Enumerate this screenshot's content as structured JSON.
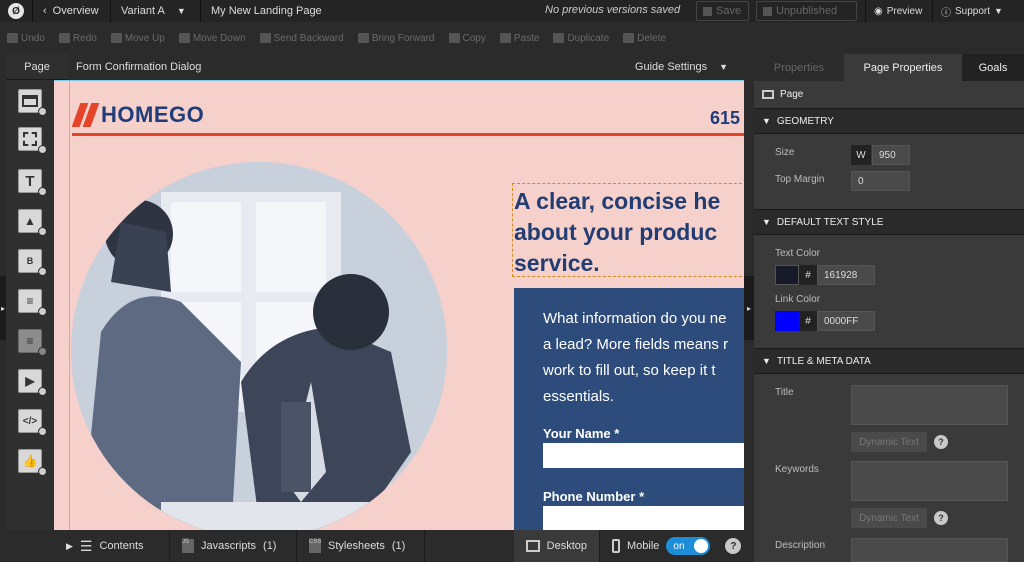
{
  "topbar": {
    "logo": "Ø",
    "back_label": "Overview",
    "variant_label": "Variant A",
    "page_name": "My New Landing Page",
    "status": "No previous versions saved",
    "save_label": "Save",
    "unpublished_label": "Unpublished",
    "preview_label": "Preview",
    "support_label": "Support"
  },
  "toolbar": {
    "items": [
      "Undo",
      "Redo",
      "Move Up",
      "Move Down",
      "Send Backward",
      "Bring Forward",
      "Copy",
      "Paste",
      "Duplicate",
      "Delete"
    ]
  },
  "left": {
    "page_tab": "Page",
    "tools": [
      "section-icon",
      "box-icon",
      "text-icon",
      "image-icon",
      "button-icon",
      "form-icon",
      "social-icon",
      "video-icon",
      "custom-html-icon",
      "social-widget-icon"
    ]
  },
  "canvas_header": {
    "title": "Form Confirmation Dialog",
    "guide_settings": "Guide Settings"
  },
  "canvas": {
    "brand": "HOMEGO",
    "phone_partial": "615",
    "headline_lines": [
      "A clear, concise he",
      "about your produc",
      "service."
    ],
    "form_description_lines": [
      "What information do you ne",
      "a lead? More fields means r",
      "work to fill out, so keep it t",
      "essentials."
    ],
    "field1_label": "Your Name *",
    "field2_label": "Phone Number *"
  },
  "bottombar": {
    "contents": "Contents",
    "javascripts": "Javascripts",
    "javascripts_count": "(1)",
    "stylesheets": "Stylesheets",
    "stylesheets_count": "(1)",
    "desktop": "Desktop",
    "mobile": "Mobile",
    "toggle": "on",
    "help": "?"
  },
  "panel": {
    "tabs": [
      "Properties",
      "Page Properties",
      "Goals"
    ],
    "page_label": "Page",
    "geometry": {
      "heading": "GEOMETRY",
      "size_label": "Size",
      "width_prefix": "W",
      "width_value": "950",
      "top_margin_label": "Top Margin",
      "top_margin_value": "0"
    },
    "text_style": {
      "heading": "DEFAULT TEXT STYLE",
      "text_color_label": "Text Color",
      "text_color_value": "161928",
      "text_color": "#161928",
      "link_color_label": "Link Color",
      "link_color_value": "0000FF",
      "link_color": "#0000FF"
    },
    "meta": {
      "heading": "TITLE & META DATA",
      "title_label": "Title",
      "keywords_label": "Keywords",
      "description_label": "Description",
      "dynamic_text": "Dynamic Text"
    }
  },
  "colors": {
    "canvas_bg": "#f6d1cb",
    "brand_blue": "#1f3d7a",
    "brand_red": "#e4452a",
    "form_bg": "#2e4c7b"
  }
}
